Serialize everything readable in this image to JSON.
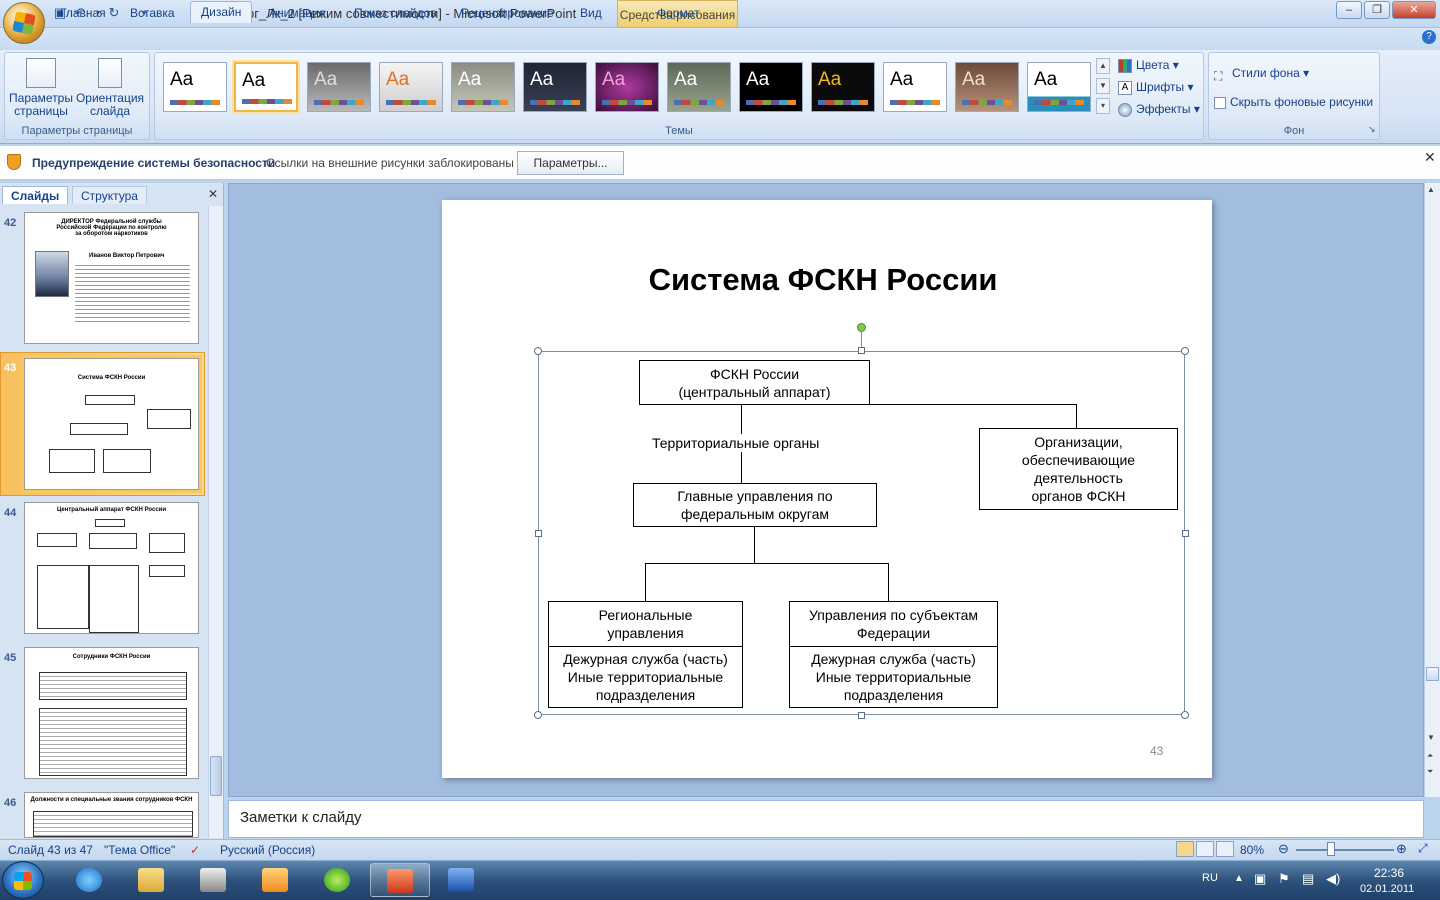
{
  "window": {
    "title": "Пр_орг_Лк_2 [Режим совместимости] - Microsoft PowerPoint",
    "contextual_tab": "Средства рисования"
  },
  "ribbon_tabs": [
    "Главная",
    "Вставка",
    "Дизайн",
    "Анимация",
    "Показ слайдов",
    "Рецензирование",
    "Вид",
    "Формат"
  ],
  "ribbon_active_tab": "Дизайн",
  "ribbon": {
    "page_setup": {
      "btn1": "Параметры страницы",
      "btn2": "Ориентация слайда",
      "group_label": "Параметры страницы"
    },
    "themes": {
      "group_label": "Темы",
      "tile_label": "Aa",
      "options": {
        "colors": "Цвета",
        "fonts": "Шрифты",
        "effects": "Эффекты"
      }
    },
    "background": {
      "styles": "Стили фона",
      "hide": "Скрыть фоновые рисунки",
      "group_label": "Фон"
    }
  },
  "security_bar": {
    "title": "Предупреждение системы безопасности",
    "message": "Ссылки на внешние рисунки заблокированы",
    "button": "Параметры..."
  },
  "left_pane": {
    "tabs": [
      "Слайды",
      "Структура"
    ],
    "slides": [
      {
        "num": "42",
        "title": "ДИРЕКТОР Федеральной службы Российской Федерации по контролю за оборотом наркотиков",
        "subtitle": "Иванов Виктор Петрович"
      },
      {
        "num": "43",
        "title": "Система ФСКН России"
      },
      {
        "num": "44",
        "title": "Центральный аппарат ФСКН России"
      },
      {
        "num": "45",
        "title": "Сотрудники ФСКН России"
      },
      {
        "num": "46",
        "title": "Должности и специальные звания сотрудников ФСКН"
      }
    ]
  },
  "slide": {
    "title": "Система ФСКН России",
    "number": "43",
    "org": {
      "top_line1": "ФСКН России",
      "top_line2": "(центральный аппарат)",
      "territorial": "Территориальные органы",
      "orgs_line1": "Организации,",
      "orgs_line2": "обеспечивающие",
      "orgs_line3": "деятельность",
      "orgs_line4": "органов ФСКН",
      "main_line1": "Главные управления по",
      "main_line2": "федеральным округам",
      "regional_line1": "Региональные",
      "regional_line2": "управления",
      "subjects_line1": "Управления по субъектам",
      "subjects_line2": "Федерации",
      "duty_line1": "Дежурная служба (часть)",
      "duty_line2": "Иные территориальные",
      "duty_line3": "подразделения"
    }
  },
  "notes_placeholder": "Заметки к слайду",
  "status": {
    "slide_counter": "Слайд 43 из 47",
    "theme": "\"Тема Office\"",
    "language": "Русский (Россия)",
    "zoom": "80%"
  },
  "taskbar": {
    "lang": "RU",
    "time": "22:36",
    "date": "02.01.2011"
  }
}
